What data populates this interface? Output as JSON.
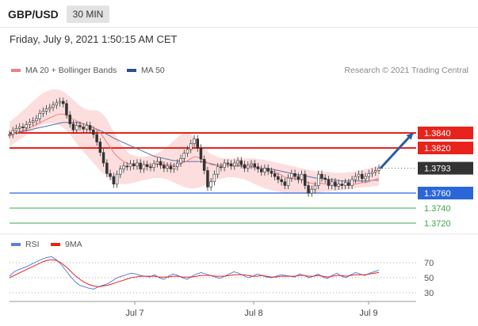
{
  "header": {
    "symbol": "GBP/USD",
    "timeframe": "30 MIN",
    "datetime": "Friday, July 9, 2021 1:50:15 AM CET"
  },
  "legend": {
    "ma20_label": "MA 20 + Bollinger Bands",
    "ma20_color": "#f08080",
    "ma50_label": "MA 50",
    "ma50_color": "#2f4f8f",
    "credit": "Research © 2021 Trading Central"
  },
  "chart_data": [
    {
      "type": "candlestick",
      "title": "GBP/USD",
      "x_tick_labels": [
        "Jul 7",
        "Jul 8",
        "Jul 9"
      ],
      "ylim": [
        1.3712,
        1.387
      ],
      "levels": [
        {
          "label": "1.3840",
          "value": 1.384,
          "kind": "resistance",
          "color": "#e8231c"
        },
        {
          "label": "1.3820",
          "value": 1.382,
          "kind": "resistance",
          "color": "#e8231c"
        },
        {
          "label": "1.3793",
          "value": 1.3793,
          "kind": "last-price",
          "color": "#333333"
        },
        {
          "label": "1.3760",
          "value": 1.376,
          "kind": "pivot",
          "color": "#2b66d9"
        },
        {
          "label": "1.3740",
          "value": 1.374,
          "kind": "support",
          "color": "#3aa84a"
        },
        {
          "label": "1.3720",
          "value": 1.372,
          "kind": "support",
          "color": "#3aa84a"
        }
      ],
      "close_series": [
        1.3838,
        1.3843,
        1.3846,
        1.3848,
        1.3847,
        1.3851,
        1.3854,
        1.3856,
        1.3859,
        1.3866,
        1.3869,
        1.3872,
        1.3874,
        1.3877,
        1.388,
        1.3882,
        1.3879,
        1.3864,
        1.3852,
        1.3844,
        1.385,
        1.3848,
        1.3845,
        1.385,
        1.3844,
        1.3838,
        1.3828,
        1.3814,
        1.38,
        1.3786,
        1.3782,
        1.3772,
        1.3785,
        1.3792,
        1.3796,
        1.3795,
        1.3799,
        1.3796,
        1.38,
        1.3792,
        1.3798,
        1.3795,
        1.3794,
        1.3799,
        1.3802,
        1.3797,
        1.3793,
        1.3796,
        1.3792,
        1.3795,
        1.38,
        1.3806,
        1.3813,
        1.3818,
        1.3826,
        1.3832,
        1.382,
        1.3805,
        1.379,
        1.3768,
        1.3775,
        1.3785,
        1.3795,
        1.3794,
        1.38,
        1.3799,
        1.3796,
        1.38,
        1.3803,
        1.3798,
        1.3793,
        1.3797,
        1.3799,
        1.3795,
        1.3792,
        1.3788,
        1.3793,
        1.3789,
        1.3786,
        1.3782,
        1.3778,
        1.3775,
        1.377,
        1.378,
        1.3786,
        1.3782,
        1.3778,
        1.3785,
        1.377,
        1.376,
        1.3765,
        1.377,
        1.3785,
        1.378,
        1.3778,
        1.377,
        1.3775,
        1.3769,
        1.3772,
        1.377,
        1.3774,
        1.377,
        1.3778,
        1.3782,
        1.3785,
        1.3779,
        1.3782,
        1.3786,
        1.3788,
        1.379,
        1.3793
      ],
      "ma20_series": [
        1.3836,
        1.3838,
        1.384,
        1.3842,
        1.3843,
        1.3845,
        1.3847,
        1.3849,
        1.3851,
        1.3853,
        1.3856,
        1.3858,
        1.386,
        1.3862,
        1.3864,
        1.3865,
        1.3865,
        1.3863,
        1.3861,
        1.3858,
        1.3856,
        1.3854,
        1.3852,
        1.3851,
        1.3849,
        1.3847,
        1.3844,
        1.384,
        1.3834,
        1.3827,
        1.3821,
        1.3814,
        1.3809,
        1.3805,
        1.3802,
        1.38,
        1.3798,
        1.3797,
        1.3797,
        1.3796,
        1.3797,
        1.3797,
        1.3797,
        1.3797,
        1.3798,
        1.3798,
        1.3798,
        1.3798,
        1.3797,
        1.3797,
        1.3797,
        1.3799,
        1.3801,
        1.3803,
        1.3806,
        1.3808,
        1.3808,
        1.3806,
        1.3804,
        1.38,
        1.3798,
        1.3797,
        1.3797,
        1.3797,
        1.3797,
        1.3797,
        1.3796,
        1.3796,
        1.3797,
        1.3797,
        1.3796,
        1.3796,
        1.3795,
        1.3795,
        1.3794,
        1.3793,
        1.3792,
        1.3791,
        1.379,
        1.3788,
        1.3786,
        1.3784,
        1.3781,
        1.378,
        1.3779,
        1.3779,
        1.3778,
        1.3778,
        1.3776,
        1.3774,
        1.3773,
        1.3772,
        1.3773,
        1.3773,
        1.3772,
        1.3772,
        1.3772,
        1.3771,
        1.3771,
        1.3771,
        1.3771,
        1.3771,
        1.3771,
        1.3772,
        1.3773,
        1.3774,
        1.3774,
        1.3775,
        1.3777,
        1.3778,
        1.378
      ],
      "ma50_series": [
        1.3838,
        1.3839,
        1.384,
        1.3841,
        1.3842,
        1.3843,
        1.3844,
        1.3845,
        1.3846,
        1.3847,
        1.3848,
        1.3849,
        1.385,
        1.3851,
        1.3852,
        1.3853,
        1.3854,
        1.3854,
        1.3854,
        1.3854,
        1.3854,
        1.3853,
        1.3852,
        1.3851,
        1.3849,
        1.3847,
        1.3845,
        1.3843,
        1.3841,
        1.3838,
        1.3836,
        1.3833,
        1.3831,
        1.3829,
        1.3827,
        1.3825,
        1.3823,
        1.3821,
        1.3819,
        1.3817,
        1.3815,
        1.3813,
        1.3811,
        1.3809,
        1.3808,
        1.3807,
        1.3806,
        1.3805,
        1.3804,
        1.3803,
        1.3803,
        1.3802,
        1.3802,
        1.3802,
        1.3802,
        1.3802,
        1.3802,
        1.3802,
        1.3801,
        1.38,
        1.3799,
        1.3798,
        1.3797,
        1.3797,
        1.3797,
        1.3797,
        1.3796,
        1.3796,
        1.3796,
        1.3796,
        1.3795,
        1.3795,
        1.3795,
        1.3794,
        1.3794,
        1.3793,
        1.3793,
        1.3792,
        1.3792,
        1.3791,
        1.379,
        1.3789,
        1.3788,
        1.3787,
        1.3786,
        1.3785,
        1.3784,
        1.3784,
        1.3783,
        1.3782,
        1.3781,
        1.378,
        1.378,
        1.3779,
        1.3779,
        1.3778,
        1.3778,
        1.3777,
        1.3777,
        1.3776,
        1.3776,
        1.3776,
        1.3776,
        1.3776,
        1.3776,
        1.3776,
        1.3776,
        1.3776,
        1.3777,
        1.3777,
        1.3777
      ],
      "band_upper": [
        1.3855,
        1.3858,
        1.3862,
        1.3866,
        1.387,
        1.3874,
        1.3878,
        1.3882,
        1.3886,
        1.389,
        1.3893,
        1.3895,
        1.3897,
        1.3898,
        1.3898,
        1.3897,
        1.3895,
        1.3892,
        1.3888,
        1.3884,
        1.388,
        1.3876,
        1.3873,
        1.3871,
        1.387,
        1.387,
        1.387,
        1.3868,
        1.3864,
        1.3858,
        1.385,
        1.3842,
        1.3834,
        1.3826,
        1.382,
        1.3815,
        1.3812,
        1.381,
        1.3809,
        1.3808,
        1.3808,
        1.3809,
        1.381,
        1.3811,
        1.3813,
        1.3815,
        1.3818,
        1.3822,
        1.3826,
        1.383,
        1.3834,
        1.3838,
        1.384,
        1.384,
        1.3838,
        1.3834,
        1.3828,
        1.3822,
        1.3818,
        1.3815,
        1.3812,
        1.381,
        1.3808,
        1.3807,
        1.3806,
        1.3806,
        1.3806,
        1.3806,
        1.3806,
        1.3806,
        1.3806,
        1.3806,
        1.3806,
        1.3806,
        1.3805,
        1.3805,
        1.3804,
        1.3803,
        1.3802,
        1.3801,
        1.38,
        1.3799,
        1.3798,
        1.3797,
        1.3796,
        1.3795,
        1.3794,
        1.3793,
        1.3792,
        1.3791,
        1.379,
        1.3789,
        1.3789,
        1.3789,
        1.3788,
        1.3788,
        1.3787,
        1.3787,
        1.3787,
        1.3787,
        1.3787,
        1.3788,
        1.3788,
        1.3789,
        1.379,
        1.3791,
        1.3792,
        1.3793,
        1.3794,
        1.3795,
        1.3796
      ],
      "band_lower": [
        1.3822,
        1.3825,
        1.3828,
        1.3831,
        1.3834,
        1.3837,
        1.384,
        1.3843,
        1.3846,
        1.3849,
        1.3851,
        1.3852,
        1.3853,
        1.3853,
        1.3852,
        1.385,
        1.3847,
        1.3843,
        1.3838,
        1.3832,
        1.3826,
        1.382,
        1.3815,
        1.381,
        1.3805,
        1.38,
        1.3795,
        1.379,
        1.3786,
        1.3782,
        1.3779,
        1.3776,
        1.3774,
        1.3772,
        1.3772,
        1.3772,
        1.3773,
        1.3774,
        1.3775,
        1.3776,
        1.3777,
        1.3778,
        1.3779,
        1.378,
        1.378,
        1.378,
        1.3779,
        1.3778,
        1.3776,
        1.3774,
        1.3772,
        1.377,
        1.3768,
        1.3767,
        1.3766,
        1.3766,
        1.3767,
        1.3768,
        1.377,
        1.3772,
        1.3774,
        1.3776,
        1.3778,
        1.3779,
        1.378,
        1.3781,
        1.3781,
        1.3781,
        1.378,
        1.3779,
        1.3778,
        1.3776,
        1.3774,
        1.3772,
        1.377,
        1.3768,
        1.3766,
        1.3765,
        1.3764,
        1.3763,
        1.3762,
        1.3761,
        1.376,
        1.376,
        1.376,
        1.376,
        1.376,
        1.376,
        1.376,
        1.376,
        1.376,
        1.376,
        1.3761,
        1.3761,
        1.3762,
        1.3762,
        1.3763,
        1.3763,
        1.3764,
        1.3764,
        1.3765,
        1.3765,
        1.3766,
        1.3766,
        1.3767,
        1.3767,
        1.3768,
        1.3768,
        1.3769,
        1.3769,
        1.377
      ],
      "forecast_arrow": {
        "from": 1.3793,
        "to": 1.384,
        "direction": "up"
      }
    },
    {
      "type": "line",
      "title": "RSI",
      "series": [
        {
          "name": "RSI",
          "color": "#5b7fde",
          "values": [
            52,
            58,
            61,
            63,
            66,
            69,
            72,
            75,
            77,
            78,
            74,
            68,
            60,
            52,
            45,
            40,
            38,
            36,
            35,
            38,
            40,
            42,
            46,
            50,
            52,
            54,
            56,
            55,
            53,
            52,
            51,
            54,
            50,
            48,
            52,
            55,
            53,
            50,
            48,
            52,
            55,
            57,
            55,
            53,
            51,
            49,
            52,
            55,
            58,
            56,
            53,
            50,
            52,
            55,
            53,
            51,
            50,
            52,
            54,
            53,
            52,
            51,
            55,
            53,
            50,
            52,
            55,
            51,
            49,
            53,
            56,
            52,
            50,
            54,
            57,
            55,
            53,
            56,
            58,
            60
          ]
        },
        {
          "name": "9MA",
          "color": "#e8231c",
          "values": [
            50,
            53,
            56,
            59,
            62,
            65,
            68,
            71,
            73,
            74,
            73,
            70,
            65,
            59,
            53,
            48,
            44,
            41,
            39,
            38,
            39,
            40,
            42,
            44,
            46,
            48,
            50,
            51,
            52,
            52,
            52,
            52,
            51,
            51,
            51,
            52,
            52,
            51,
            51,
            51,
            52,
            53,
            53,
            53,
            52,
            52,
            52,
            53,
            54,
            54,
            54,
            53,
            52,
            52,
            53,
            52,
            51,
            51,
            52,
            52,
            52,
            52,
            53,
            53,
            52,
            52,
            53,
            52,
            51,
            52,
            53,
            53,
            52,
            53,
            54,
            54,
            54,
            55,
            56,
            57
          ]
        }
      ],
      "yticks": [
        70,
        50,
        30
      ],
      "ylim": [
        20,
        80
      ]
    }
  ],
  "rsi_legend": {
    "rsi_label": "RSI",
    "rsi_color": "#5b7fde",
    "ma_label": "9MA",
    "ma_color": "#e8231c"
  }
}
